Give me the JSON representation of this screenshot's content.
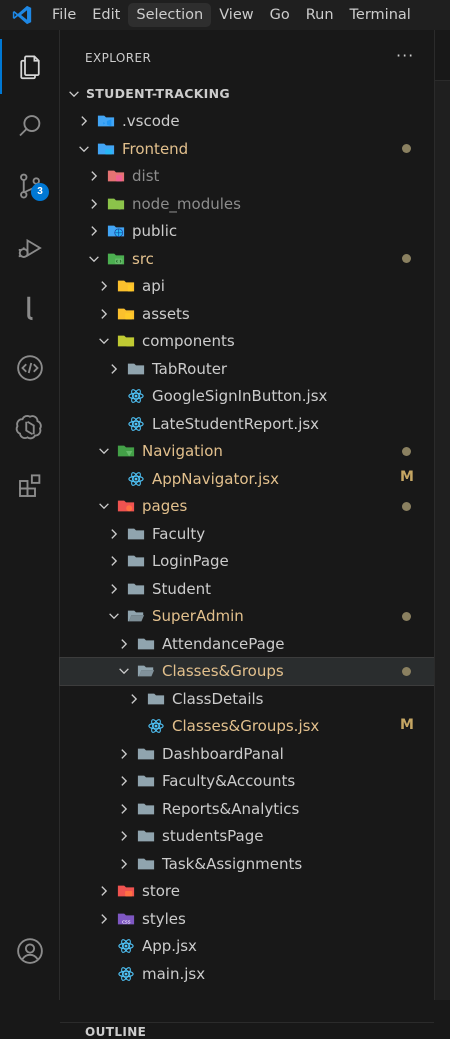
{
  "menubar": {
    "logo_icon": "vscode-logo-icon",
    "items": [
      "File",
      "Edit",
      "Selection",
      "View",
      "Go",
      "Run",
      "Terminal"
    ],
    "active_index": 2
  },
  "activity": {
    "items": [
      {
        "name": "explorer",
        "icon": "files-icon"
      },
      {
        "name": "search",
        "icon": "search-icon"
      },
      {
        "name": "source-control",
        "icon": "source-control-icon",
        "badge": "3"
      },
      {
        "name": "run-debug",
        "icon": "run-debug-icon"
      },
      {
        "name": "lingo",
        "icon": "l-extension-icon"
      },
      {
        "name": "remote",
        "icon": "code-remote-icon"
      },
      {
        "name": "chatgpt",
        "icon": "openai-icon"
      },
      {
        "name": "extensions",
        "icon": "extensions-icon"
      },
      {
        "name": "accounts",
        "icon": "account-icon"
      }
    ]
  },
  "explorer": {
    "title": "EXPLORER",
    "more": "···",
    "outline_title": "OUTLINE"
  },
  "tree": [
    {
      "label": "STUDENT-TRACKING",
      "depth": 0,
      "chevron": "down",
      "icon": "none",
      "color": "root"
    },
    {
      "label": ".vscode",
      "depth": 1,
      "chevron": "right",
      "icon": "vscode-folder-icon",
      "color": "default"
    },
    {
      "label": "Frontend",
      "depth": 1,
      "chevron": "down",
      "icon": "frontend-folder-icon",
      "color": "mod",
      "dot": true
    },
    {
      "label": "dist",
      "depth": 2,
      "chevron": "right",
      "icon": "dist-folder-icon",
      "color": "dim"
    },
    {
      "label": "node_modules",
      "depth": 2,
      "chevron": "right",
      "icon": "node-folder-icon",
      "color": "dim"
    },
    {
      "label": "public",
      "depth": 2,
      "chevron": "right",
      "icon": "public-folder-icon",
      "color": "default"
    },
    {
      "label": "src",
      "depth": 2,
      "chevron": "down",
      "icon": "src-folder-icon",
      "color": "mod",
      "dot": true
    },
    {
      "label": "api",
      "depth": 3,
      "chevron": "right",
      "icon": "api-folder-icon",
      "color": "default"
    },
    {
      "label": "assets",
      "depth": 3,
      "chevron": "right",
      "icon": "assets-folder-icon",
      "color": "default"
    },
    {
      "label": "components",
      "depth": 3,
      "chevron": "down",
      "icon": "components-folder-icon",
      "color": "default"
    },
    {
      "label": "TabRouter",
      "depth": 4,
      "chevron": "right",
      "icon": "folder-icon",
      "color": "default"
    },
    {
      "label": "GoogleSignInButton.jsx",
      "depth": 4,
      "chevron": "none",
      "icon": "react-icon",
      "color": "default"
    },
    {
      "label": "LateStudentReport.jsx",
      "depth": 4,
      "chevron": "none",
      "icon": "react-icon",
      "color": "default"
    },
    {
      "label": "Navigation",
      "depth": 3,
      "chevron": "down",
      "icon": "navigation-folder-icon",
      "color": "mod",
      "dot": true
    },
    {
      "label": "AppNavigator.jsx",
      "depth": 4,
      "chevron": "none",
      "icon": "react-icon",
      "color": "mod",
      "mark": "M"
    },
    {
      "label": "pages",
      "depth": 3,
      "chevron": "down",
      "icon": "pages-folder-icon",
      "color": "mod",
      "dot": true
    },
    {
      "label": "Faculty",
      "depth": 4,
      "chevron": "right",
      "icon": "folder-icon",
      "color": "default"
    },
    {
      "label": "LoginPage",
      "depth": 4,
      "chevron": "right",
      "icon": "folder-icon",
      "color": "default"
    },
    {
      "label": "Student",
      "depth": 4,
      "chevron": "right",
      "icon": "folder-icon",
      "color": "default"
    },
    {
      "label": "SuperAdmin",
      "depth": 4,
      "chevron": "down",
      "icon": "folder-open-icon",
      "color": "mod",
      "dot": true
    },
    {
      "label": "AttendancePage",
      "depth": 5,
      "chevron": "right",
      "icon": "folder-icon",
      "color": "default"
    },
    {
      "label": "Classes&Groups",
      "depth": 5,
      "chevron": "down",
      "icon": "folder-open-icon",
      "color": "mod",
      "dot": true,
      "selected": true
    },
    {
      "label": "ClassDetails",
      "depth": 6,
      "chevron": "right",
      "icon": "folder-icon",
      "color": "default"
    },
    {
      "label": "Classes&Groups.jsx",
      "depth": 6,
      "chevron": "none",
      "icon": "react-icon",
      "color": "mod",
      "mark": "M"
    },
    {
      "label": "DashboardPanal",
      "depth": 5,
      "chevron": "right",
      "icon": "folder-icon",
      "color": "default"
    },
    {
      "label": "Faculty&Accounts",
      "depth": 5,
      "chevron": "right",
      "icon": "folder-icon",
      "color": "default"
    },
    {
      "label": "Reports&Analytics",
      "depth": 5,
      "chevron": "right",
      "icon": "folder-icon",
      "color": "default"
    },
    {
      "label": "studentsPage",
      "depth": 5,
      "chevron": "right",
      "icon": "folder-icon",
      "color": "default"
    },
    {
      "label": "Task&Assignments",
      "depth": 5,
      "chevron": "right",
      "icon": "folder-icon",
      "color": "default"
    },
    {
      "label": "store",
      "depth": 3,
      "chevron": "right",
      "icon": "store-folder-icon",
      "color": "default"
    },
    {
      "label": "styles",
      "depth": 3,
      "chevron": "right",
      "icon": "css-folder-icon",
      "color": "default"
    },
    {
      "label": "App.jsx",
      "depth": 3,
      "chevron": "none",
      "icon": "react-icon",
      "color": "default"
    },
    {
      "label": "main.jsx",
      "depth": 3,
      "chevron": "none",
      "icon": "react-icon",
      "color": "default"
    }
  ],
  "colors": {
    "accent": "#0078d4",
    "modified": "#e2c08d",
    "react": "#4fc3f7",
    "folder": "#90a4ae"
  }
}
